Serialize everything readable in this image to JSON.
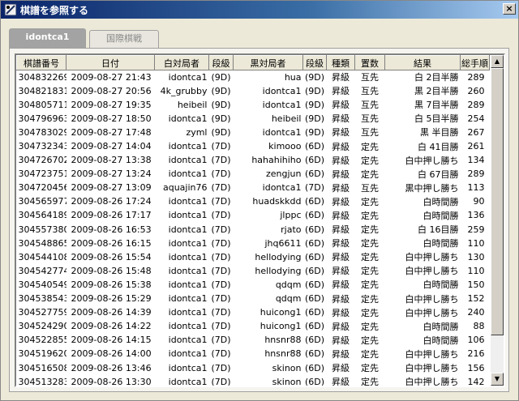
{
  "window": {
    "title": "棋譜を参照する",
    "close_label": "×"
  },
  "tabs": [
    {
      "label": "idontca1",
      "active": true
    },
    {
      "label": "国際棋戦",
      "active": false
    }
  ],
  "columns": [
    "棋譜番号",
    "日付",
    "白対局者",
    "段級",
    "黒対局者",
    "段級",
    "種類",
    "置数",
    "結果",
    "総手順"
  ],
  "rows": [
    [
      "304832269",
      "2009-08-27 21:43",
      "idontca1",
      "(9D)",
      "hua",
      "(9D)",
      "昇級",
      "互先",
      "白 2目半勝",
      "289"
    ],
    [
      "304821831",
      "2009-08-27 20:56",
      "4k_grubby",
      "(9D)",
      "idontca1",
      "(9D)",
      "昇級",
      "互先",
      "黒 2目半勝",
      "260"
    ],
    [
      "304805711",
      "2009-08-27 19:35",
      "heibeil",
      "(9D)",
      "idontca1",
      "(9D)",
      "昇級",
      "互先",
      "黒 7目半勝",
      "289"
    ],
    [
      "304796963",
      "2009-08-27 18:50",
      "idontca1",
      "(9D)",
      "heibeil",
      "(9D)",
      "昇級",
      "互先",
      "白 5目半勝",
      "254"
    ],
    [
      "304783029",
      "2009-08-27 17:48",
      "zyml",
      "(9D)",
      "idontca1",
      "(9D)",
      "昇級",
      "互先",
      "黒 半目勝",
      "267"
    ],
    [
      "304732343",
      "2009-08-27 14:04",
      "idontca1",
      "(7D)",
      "kimooo",
      "(6D)",
      "昇級",
      "定先",
      "白 41目勝",
      "261"
    ],
    [
      "304726702",
      "2009-08-27 13:38",
      "idontca1",
      "(7D)",
      "hahahihiho",
      "(6D)",
      "昇級",
      "定先",
      "白中押し勝ち",
      "134"
    ],
    [
      "304723751",
      "2009-08-27 13:24",
      "idontca1",
      "(7D)",
      "zengjun",
      "(6D)",
      "昇級",
      "定先",
      "白 67目勝",
      "289"
    ],
    [
      "304720456",
      "2009-08-27 13:09",
      "aquajin76",
      "(7D)",
      "idontca1",
      "(7D)",
      "昇級",
      "互先",
      "黒中押し勝ち",
      "113"
    ],
    [
      "304565977",
      "2009-08-26 17:24",
      "idontca1",
      "(7D)",
      "huadskkdd",
      "(6D)",
      "昇級",
      "定先",
      "白時間勝",
      "90"
    ],
    [
      "304564189",
      "2009-08-26 17:17",
      "idontca1",
      "(7D)",
      "jlppc",
      "(6D)",
      "昇級",
      "定先",
      "白時間勝",
      "136"
    ],
    [
      "304557380",
      "2009-08-26 16:53",
      "idontca1",
      "(7D)",
      "rjato",
      "(6D)",
      "昇級",
      "定先",
      "白 16目勝",
      "259"
    ],
    [
      "304548865",
      "2009-08-26 16:15",
      "idontca1",
      "(7D)",
      "jhq6611",
      "(6D)",
      "昇級",
      "定先",
      "白時間勝",
      "110"
    ],
    [
      "304544108",
      "2009-08-26 15:54",
      "idontca1",
      "(7D)",
      "hellodying",
      "(6D)",
      "昇級",
      "定先",
      "白中押し勝ち",
      "130"
    ],
    [
      "304542774",
      "2009-08-26 15:48",
      "idontca1",
      "(7D)",
      "hellodying",
      "(6D)",
      "昇級",
      "定先",
      "白中押し勝ち",
      "110"
    ],
    [
      "304540549",
      "2009-08-26 15:38",
      "idontca1",
      "(7D)",
      "qdqm",
      "(6D)",
      "昇級",
      "定先",
      "白時間勝",
      "150"
    ],
    [
      "304538543",
      "2009-08-26 15:29",
      "idontca1",
      "(7D)",
      "qdqm",
      "(6D)",
      "昇級",
      "定先",
      "白中押し勝ち",
      "152"
    ],
    [
      "304527759",
      "2009-08-26 14:39",
      "idontca1",
      "(7D)",
      "huicong1",
      "(6D)",
      "昇級",
      "定先",
      "白中押し勝ち",
      "240"
    ],
    [
      "304524290",
      "2009-08-26 14:22",
      "idontca1",
      "(7D)",
      "huicong1",
      "(6D)",
      "昇級",
      "定先",
      "白時間勝",
      "88"
    ],
    [
      "304522855",
      "2009-08-26 14:15",
      "idontca1",
      "(7D)",
      "hnsnr88",
      "(6D)",
      "昇級",
      "定先",
      "白時間勝",
      "106"
    ],
    [
      "304519620",
      "2009-08-26 14:00",
      "idontca1",
      "(7D)",
      "hnsnr88",
      "(6D)",
      "昇級",
      "定先",
      "白中押し勝ち",
      "216"
    ],
    [
      "304516508",
      "2009-08-26 13:46",
      "idontca1",
      "(7D)",
      "skinon",
      "(6D)",
      "昇級",
      "定先",
      "白中押し勝ち",
      "156"
    ],
    [
      "304513283",
      "2009-08-26 13:30",
      "idontca1",
      "(7D)",
      "skinon",
      "(6D)",
      "昇級",
      "定先",
      "白中押し勝ち",
      "142"
    ]
  ],
  "scroll": {
    "up_arrow": "▲",
    "down_arrow": "▼"
  }
}
